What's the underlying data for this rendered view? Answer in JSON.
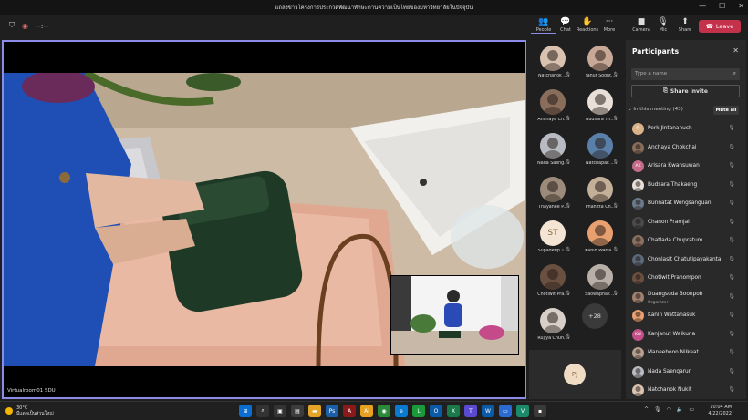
{
  "window": {
    "title": "แถลงข่าวโครงการประกวดพัฒนาทักษะด้านความเป็นไทยของมหาวิทยาลัยในปัจจุบัน"
  },
  "toolbar": {
    "timer": "--:--",
    "people": "People",
    "chat": "Chat",
    "reactions": "Reactions",
    "more": "More",
    "camera": "Camera",
    "mic": "Mic",
    "share": "Share",
    "leave": "Leave"
  },
  "stage": {
    "label": "Virtualroom01 SDU"
  },
  "gallery": [
    {
      "name": "Natchanok ...",
      "color": "#d9c2b0"
    },
    {
      "name": "Yanut Soont...",
      "color": "#c8a896"
    },
    {
      "name": "Anchaya Ch...",
      "color": "#8a6e5c"
    },
    {
      "name": "Budsara Th...",
      "color": "#e8e0d8"
    },
    {
      "name": "Nada Saeng...",
      "color": "#b8bcc2"
    },
    {
      "name": "Natchapak ...",
      "color": "#5a7fa8"
    },
    {
      "name": "Thayanee P...",
      "color": "#9c8a7a"
    },
    {
      "name": "Phanitta Ch...",
      "color": "#c4b098"
    },
    {
      "name": "Supadetip T...",
      "initials": "ST",
      "color": "#f4e4d4"
    },
    {
      "name": "Kanin Watta...",
      "color": "#e8a070"
    },
    {
      "name": "Chotiwit Pra...",
      "color": "#6a5040"
    },
    {
      "name": "Saowaphak ...",
      "color": "#b8b0a8"
    },
    {
      "name": "Rujiya Chun...",
      "color": "#d8d0c8"
    }
  ],
  "gallery_more": "+28",
  "self": {
    "initials": "PJ"
  },
  "panel": {
    "title": "Participants",
    "search_placeholder": "Type a name",
    "share_invite": "Share invite",
    "section": "In this meeting (43)",
    "mute_all": "Mute all",
    "participants": [
      {
        "name": "Perk Jintananuch",
        "initials": "PJ",
        "color": "#d9b48a"
      },
      {
        "name": "Anchaya Chokchai",
        "color": "#8a6e5c"
      },
      {
        "name": "Arisara Kwansuwan",
        "initials": "AK",
        "color": "#c46a8a"
      },
      {
        "name": "Budsara Thakaeng",
        "color": "#e8e0d8"
      },
      {
        "name": "Bunnatat Wongsanguan",
        "color": "#6a7a8a"
      },
      {
        "name": "Chanon Pramjai",
        "color": "#4a4a4a"
      },
      {
        "name": "Chatlada Chupratum",
        "color": "#8a7060"
      },
      {
        "name": "Chonlasit Chatutipayakanta",
        "color": "#5a6a7a"
      },
      {
        "name": "Chotiwit Pranompon",
        "color": "#6a5040"
      },
      {
        "name": "Duangsuda Boonpob",
        "role": "Organizer",
        "color": "#a08070"
      },
      {
        "name": "Kanin Wattanasuk",
        "color": "#e8a070"
      },
      {
        "name": "Kanjanut Waikuna",
        "initials": "KW",
        "color": "#c4508a"
      },
      {
        "name": "Maneeboon Nilkeat",
        "color": "#b8a090"
      },
      {
        "name": "Nada Saengarun",
        "color": "#b8bcc2"
      },
      {
        "name": "Natchanok Nukit",
        "color": "#d9c2b0"
      }
    ]
  },
  "taskbar": {
    "temp": "30°C",
    "condition": "มีแดดเป็นส่วนใหญ่",
    "time": "10:04 AM",
    "date": "4/22/2022"
  }
}
